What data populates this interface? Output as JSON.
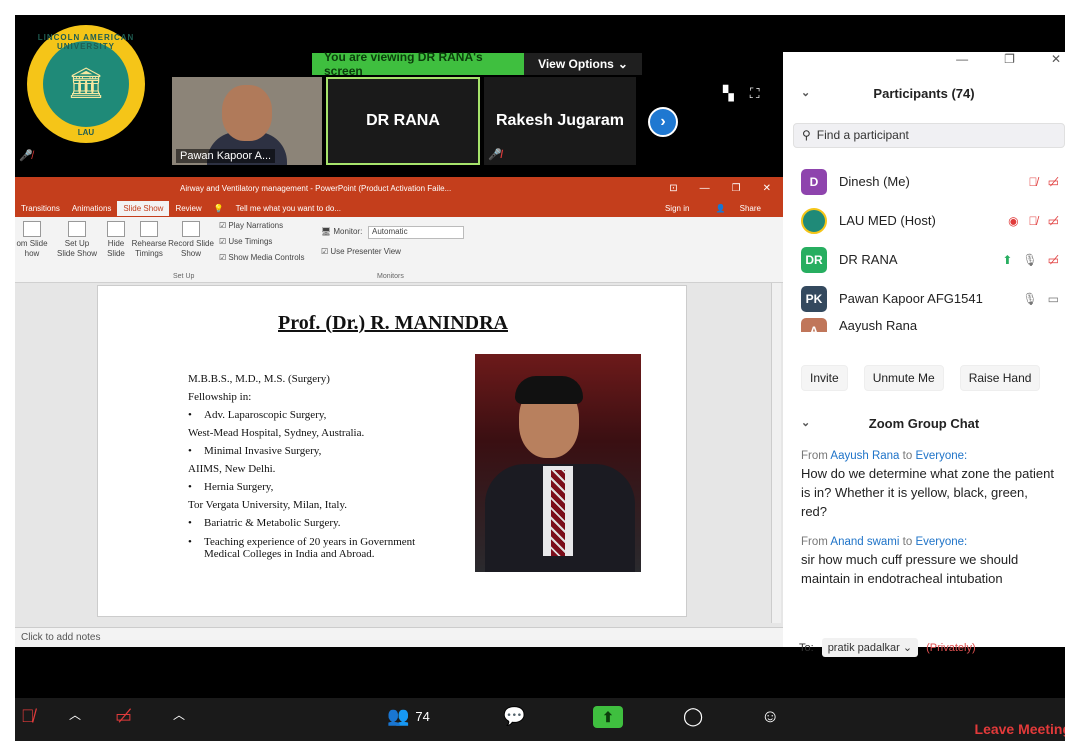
{
  "share_banner": {
    "viewing_text": "You are viewing DR RANA's screen",
    "view_options": "View Options"
  },
  "logo": {
    "ring_text": "LINCOLN AMERICAN UNIVERSITY",
    "abbrev": "LAU"
  },
  "video_tiles": [
    {
      "name": "Pawan Kapoor A..."
    },
    {
      "name": "DR RANA"
    },
    {
      "name": "Rakesh Jugaram"
    }
  ],
  "ppt": {
    "title": "Airway and Ventilatory management - PowerPoint (Product Activation Faile...",
    "tabs": [
      "Transitions",
      "Animations",
      "Slide Show",
      "Review"
    ],
    "tell_me": "Tell me what you want to do...",
    "sign_in": "Sign in",
    "share": "Share",
    "ribbon": {
      "custom_slide": "om Slide\nhow",
      "setup": "Set Up\nSlide Show",
      "hide": "Hide\nSlide",
      "rehearse": "Rehearse\nTimings",
      "record": "Record Slide\nShow",
      "play_narrations": "Play Narrations",
      "use_timings": "Use Timings",
      "show_media": "Show Media Controls",
      "monitor_label": "Monitor:",
      "monitor_value": "Automatic",
      "presenter_view": "Use Presenter View",
      "group_setup": "Set Up",
      "group_monitors": "Monitors"
    },
    "slide": {
      "title": "Prof. (Dr.) R. MANINDRA",
      "qualifications": "M.B.B.S., M.D., M.S. (Surgery)",
      "fellowship": "Fellowship in:",
      "b1": "Adv. Laparoscopic Surgery,",
      "l1": "West-Mead Hospital, Sydney, Australia.",
      "b2": "Minimal Invasive Surgery,",
      "l2": "AIIMS, New Delhi.",
      "b3": "Hernia Surgery,",
      "l3": "Tor Vergata University, Milan, Italy.",
      "b4": "Bariatric & Metabolic Surgery.",
      "b5": "Teaching experience of 20 years in Government Medical Colleges in India and Abroad."
    },
    "notes": "Click to add notes"
  },
  "participants": {
    "header": "Participants (74)",
    "search_placeholder": "Find a participant",
    "list": [
      {
        "initials": "D",
        "name": "Dinesh (Me)",
        "color": "#8e44ad"
      },
      {
        "initials": "",
        "name": "LAU MED (Host)",
        "color": "#1f8a78"
      },
      {
        "initials": "DR",
        "name": "DR RANA",
        "color": "#27ae60"
      },
      {
        "initials": "PK",
        "name": "Pawan Kapoor AFG1541",
        "color": "#34495e"
      },
      {
        "initials": "A",
        "name": "Aayush Rana",
        "color": "#c0765a"
      }
    ],
    "buttons": {
      "invite": "Invite",
      "unmute": "Unmute Me",
      "raise_hand": "Raise Hand"
    }
  },
  "chat": {
    "header": "Zoom Group Chat",
    "messages": [
      {
        "from_label": "From",
        "sender": "Aayush Rana",
        "to_label": "to",
        "recipient": "Everyone:",
        "text": "How do we determine what zone the patient is in? Whether it is yellow, black, green, red?"
      },
      {
        "from_label": "From",
        "sender": "Anand swami",
        "to_label": "to",
        "recipient": "Everyone:",
        "text": "sir how much cuff pressure we should maintain in endotracheal intubation"
      }
    ],
    "to_label": "To:",
    "to_value": "pratik padalkar",
    "privately": "(Privately)"
  },
  "toolbar": {
    "participant_count": "74",
    "leave": "Leave Meeting"
  }
}
